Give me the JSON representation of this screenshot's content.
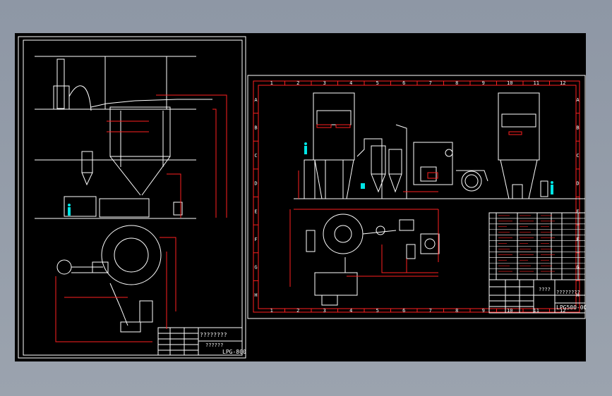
{
  "left_sheet": {
    "title_marks": "????????",
    "title_sub": "??????",
    "drawing_no": "LPG-800"
  },
  "right_sheet": {
    "grid_cols": [
      "1",
      "2",
      "3",
      "4",
      "5",
      "6",
      "7",
      "8",
      "9",
      "10",
      "11",
      "12"
    ],
    "grid_rows": [
      "A",
      "B",
      "C",
      "D",
      "E",
      "F",
      "G",
      "H"
    ],
    "title_marks": "????????",
    "title_sub": "????",
    "drawing_no": "LPG500-00"
  },
  "colors": {
    "background": "#000000",
    "frame": "#ffffff",
    "dimension": "#ff2020",
    "accent": "#00e5e5"
  }
}
